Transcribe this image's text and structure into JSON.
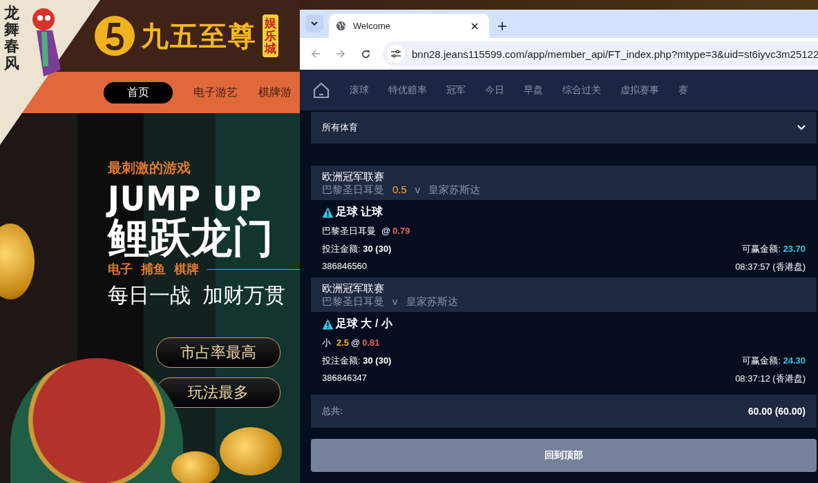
{
  "site": {
    "vertical_text": "龙舞春风",
    "logo_name": "九五至尊",
    "logo_badge": "娱乐城",
    "nav": [
      {
        "label": "首页",
        "selected": true
      },
      {
        "label": "电子游艺",
        "selected": false
      },
      {
        "label": "棋牌游",
        "selected": false
      }
    ],
    "banner": {
      "kicker": "最刺激的游戏",
      "headline": "JUMP UP",
      "title": "鲤跃龙门",
      "categories": [
        "电子",
        "捕鱼",
        "棋牌"
      ],
      "slogan": "每日一战  加财万贯",
      "buttons": [
        "市占率最高",
        "玩法最多"
      ]
    }
  },
  "browser": {
    "tab_title": "Welcome",
    "url": "bnn28.jeans115599.com/app/member_api/FT_index.php?mtype=3&uid=st6iyvc3m25122"
  },
  "app": {
    "nav": [
      "滚球",
      "特优赔率",
      "冠军",
      "今日",
      "早盘",
      "综合过关",
      "虚拟赛事",
      "赛"
    ],
    "sport_select": "所有体育",
    "bets": [
      {
        "league": "欧洲冠军联赛",
        "home": "巴黎圣日耳曼",
        "line": "0.5",
        "vs": "v",
        "away": "皇家苏斯达",
        "market": "足球 让球",
        "selection": "巴黎圣日耳曼",
        "at": "@",
        "odds": "0.79",
        "stake_label": "投注金额:",
        "stake": "30 (30)",
        "win_label": "可赢金额:",
        "win": "23.70",
        "ticket": "386846560",
        "time": "08:37:57 (香港盘)"
      },
      {
        "league": "欧洲冠军联赛",
        "home": "巴黎圣日耳曼",
        "vs": "v",
        "away": "皇家苏斯达",
        "market": "足球 大 / 小",
        "selection": "小",
        "selection_line": "2.5",
        "at": "@",
        "odds": "0.81",
        "stake_label": "投注金额:",
        "stake": "30 (30)",
        "win_label": "可赢金额:",
        "win": "24.30",
        "ticket": "386846347",
        "time": "08:37:12 (香港盘)"
      }
    ],
    "total_label": "总共:",
    "total": "60.00 (60.00)",
    "back_to_top": "回到顶部"
  }
}
